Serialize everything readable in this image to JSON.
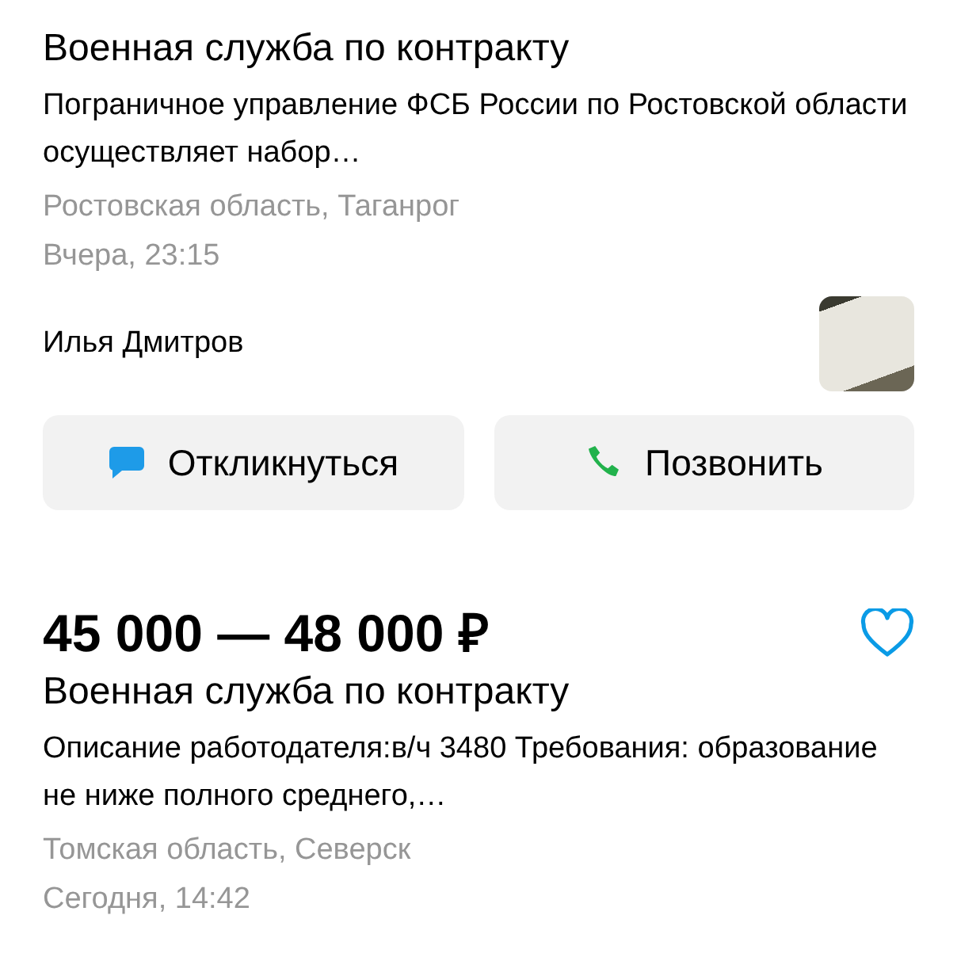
{
  "listings": [
    {
      "title": "Военная служба по контракту",
      "description": "Пограничное управление ФСБ России по Ростовской области осуществляет набор…",
      "location": "Ростовская область, Таганрог",
      "date": "Вчера, 23:15",
      "author": "Илья Дмитров",
      "buttons": [
        {
          "kind": "reply",
          "label": "Откликнуться"
        },
        {
          "kind": "call",
          "label": "Позвонить"
        }
      ]
    },
    {
      "price": "45 000 — 48 000 ₽",
      "favorite": false,
      "title": "Военная служба по контракту",
      "description": "Описание работодателя:в/ч 3480 Требования: образование не ниже полного среднего,…",
      "location": "Томская область, Северск",
      "date": "Сегодня, 14:42"
    }
  ]
}
